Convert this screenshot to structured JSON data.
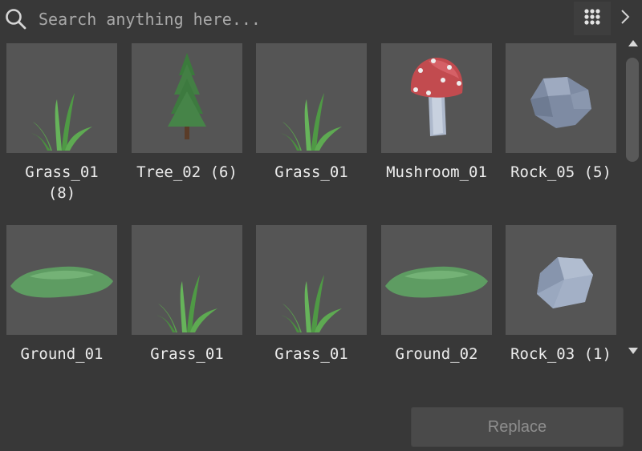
{
  "search": {
    "placeholder": "Search anything here..."
  },
  "toolbar": {
    "grid_icon": "grid-dots-icon",
    "chevron_icon": "chevron-right-icon"
  },
  "assets": [
    {
      "label": "Grass_01\n(8)",
      "kind": "grass"
    },
    {
      "label": "Tree_02 (6)",
      "kind": "tree"
    },
    {
      "label": "Grass_01",
      "kind": "grass"
    },
    {
      "label": "Mushroom_01",
      "kind": "mushroom"
    },
    {
      "label": "Rock_05 (5)",
      "kind": "rock"
    },
    {
      "label": "Ground_01",
      "kind": "ground"
    },
    {
      "label": "Grass_01",
      "kind": "grass"
    },
    {
      "label": "Grass_01",
      "kind": "grass"
    },
    {
      "label": "Ground_02",
      "kind": "ground"
    },
    {
      "label": "Rock_03 (1)",
      "kind": "rock2"
    }
  ],
  "footer": {
    "replace_label": "Replace"
  },
  "colors": {
    "background": "#383838",
    "tile": "#555555",
    "grass": "#5fa552",
    "rock": "#8d9bb4"
  }
}
